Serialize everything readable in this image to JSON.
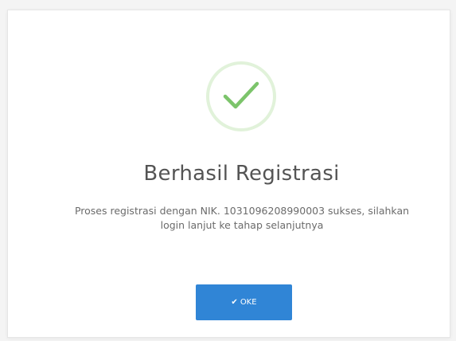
{
  "dialog": {
    "title": "Berhasil Registrasi",
    "message": "Proses registrasi dengan NIK. 1031096208990003 sukses, silahkan login lanjut ke tahap selanjutnya",
    "icon": "success-check-icon",
    "ok_button": {
      "icon": "check-icon",
      "label": "OKE"
    }
  },
  "colors": {
    "button": "#3085d6",
    "success": "#7cc46b",
    "success_ring": "#e1f2da",
    "title": "#545454",
    "message": "#6b6b6b"
  }
}
